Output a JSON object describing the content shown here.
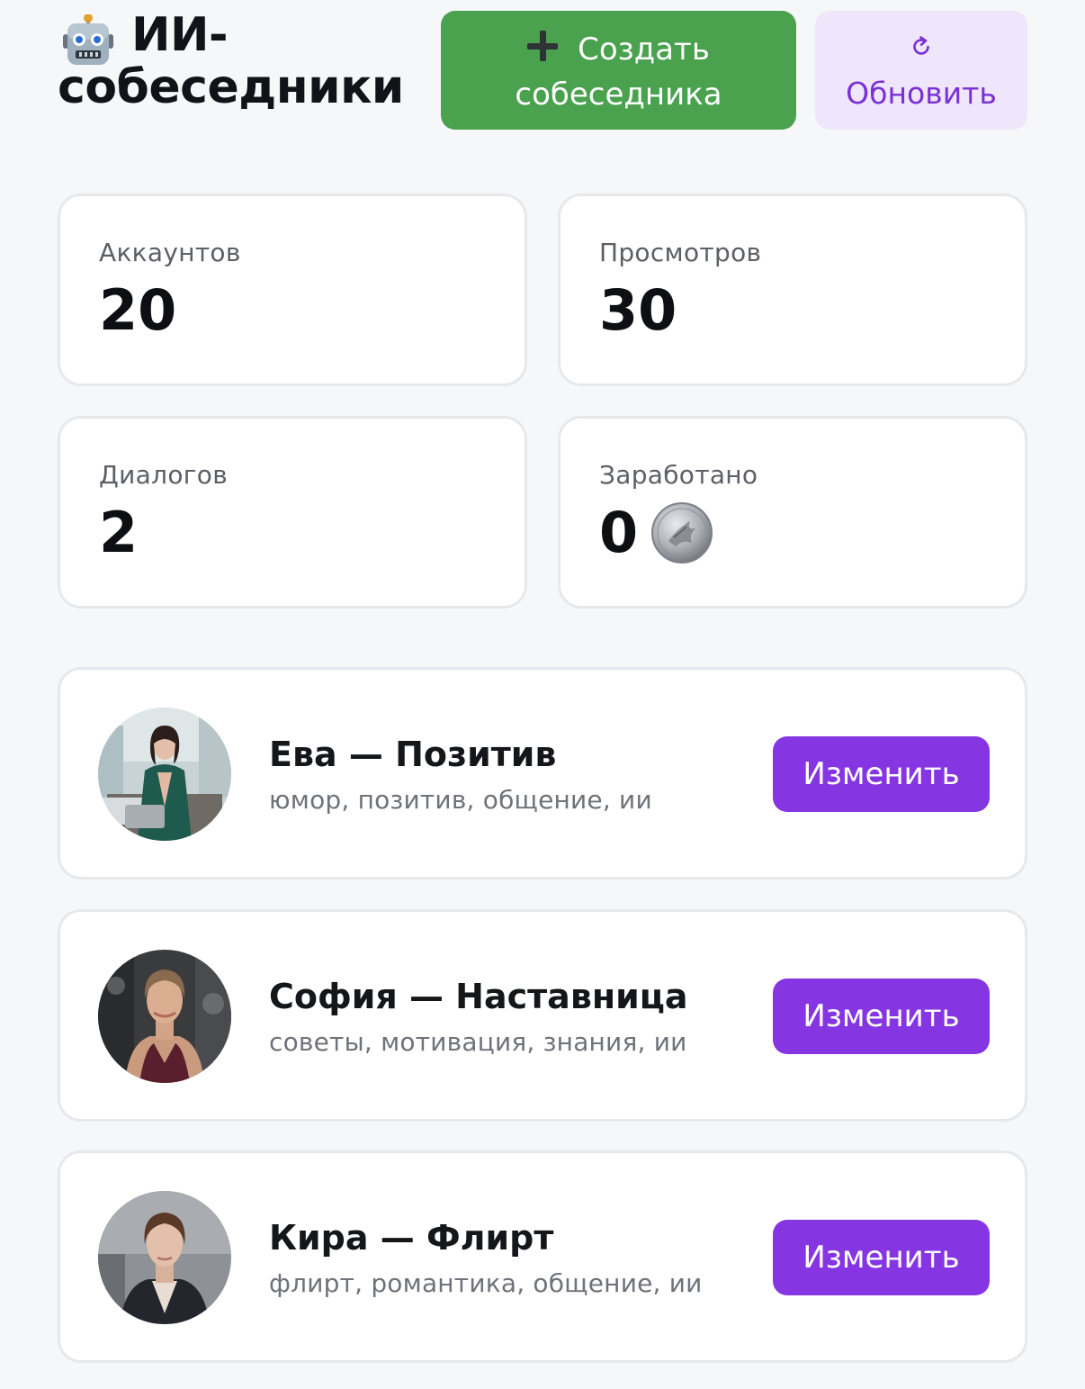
{
  "header": {
    "title": "ИИ-собеседники",
    "title_icon": "robot-face-icon",
    "create_button": {
      "label": "Создать собеседника",
      "icon": "plus-icon"
    },
    "refresh_button": {
      "label": "Обновить",
      "icon": "refresh-icon"
    }
  },
  "stats": [
    {
      "label": "Аккаунтов",
      "value": "20"
    },
    {
      "label": "Просмотров",
      "value": "30"
    },
    {
      "label": "Диалогов",
      "value": "2"
    },
    {
      "label": "Заработано",
      "value": "0",
      "icon": "silver-coin-icon"
    }
  ],
  "personas": [
    {
      "name": "Ева — Позитив",
      "tags": "юмор, позитив, общение, ии",
      "edit_label": "Изменить"
    },
    {
      "name": "София — Наставница",
      "tags": "советы, мотивация, знания, ии",
      "edit_label": "Изменить"
    },
    {
      "name": "Кира — Флирт",
      "tags": "флирт, романтика, общение, ии",
      "edit_label": "Изменить"
    }
  ],
  "colors": {
    "create_button": "#4aa14e",
    "refresh_button_bg": "#efe6fb",
    "refresh_button_text": "#7a2fd8",
    "edit_button": "#8635e3",
    "background": "#f6f7f9",
    "card_border": "#e6e8ec"
  }
}
